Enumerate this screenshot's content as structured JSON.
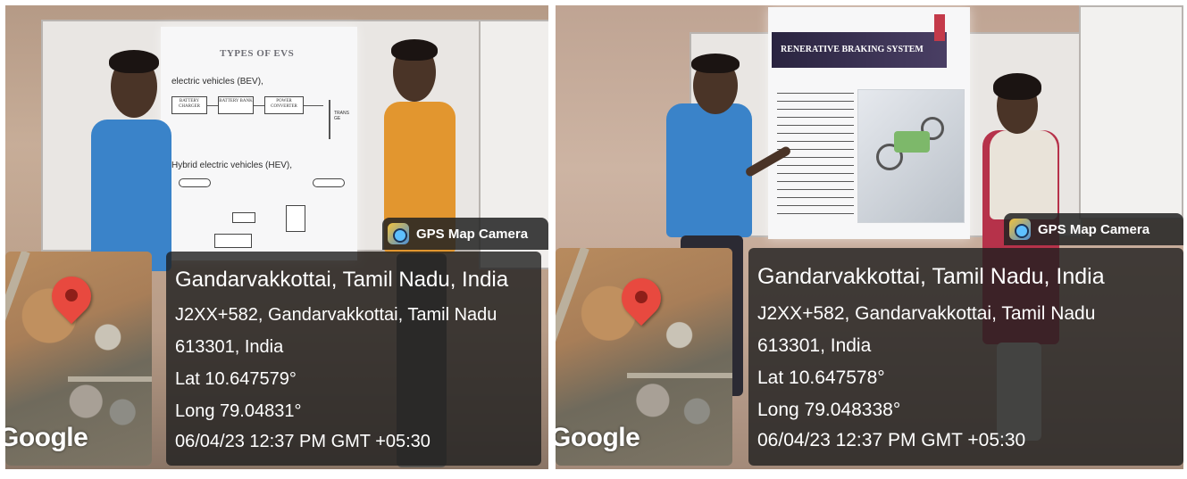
{
  "left": {
    "slide": {
      "title": "TYPES OF EVS",
      "bullet1": "electric vehicles (BEV),",
      "bullet2": "Hybrid electric vehicles (HEV),",
      "box1": "BATTERY CHARGER",
      "box2": "BATTERY BANK",
      "box3": "POWER CONVERTER",
      "box4": "TRANS GE"
    },
    "gps": {
      "app_name": "GPS Map Camera",
      "place": "Gandarvakkottai, Tamil Nadu, India",
      "address_line1": "J2XX+582, Gandarvakkottai, Tamil Nadu",
      "address_line2": "613301, India",
      "lat": "Lat 10.647579°",
      "long": "Long 79.04831°",
      "datetime": "06/04/23 12:37 PM GMT +05:30",
      "map_brand": "Google"
    }
  },
  "right": {
    "slide": {
      "title": "RENERATIVE BRAKING SYSTEM"
    },
    "gps": {
      "app_name": "GPS Map Camera",
      "place": "Gandarvakkottai, Tamil Nadu, India",
      "address_line1": "J2XX+582, Gandarvakkottai, Tamil Nadu",
      "address_line2": "613301, India",
      "lat": "Lat 10.647578°",
      "long": "Long 79.048338°",
      "datetime": "06/04/23 12:37 PM GMT +05:30",
      "map_brand": "Google"
    }
  },
  "colors": {
    "overlay": "#232323",
    "pin": "#e8493f",
    "shirt_blue": "#3a83c9",
    "shirt_orange": "#e2962f"
  }
}
